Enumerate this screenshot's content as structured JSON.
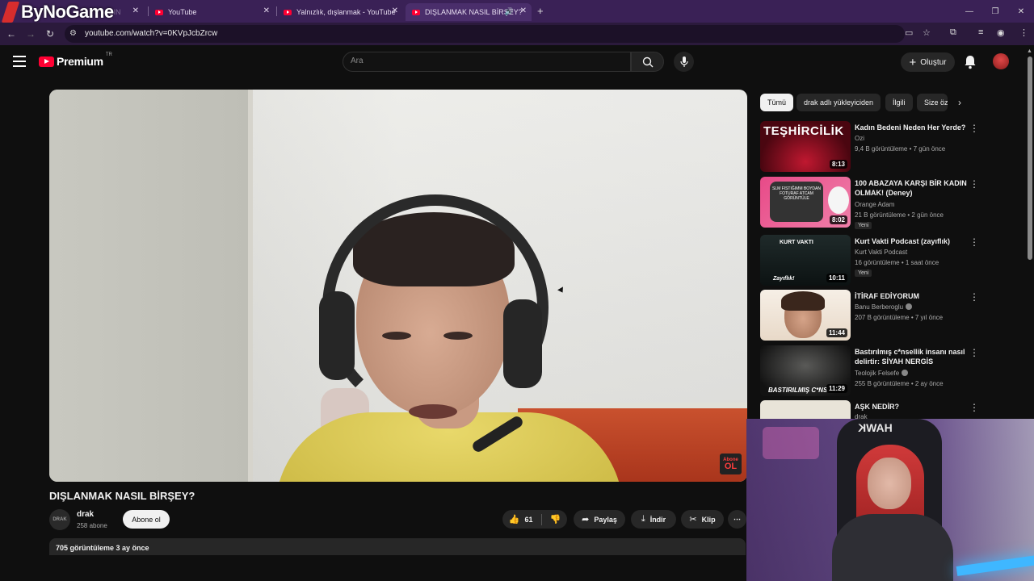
{
  "browser": {
    "watermark": "ByNoGame",
    "tabs": [
      {
        "title": "ÇIN"
      },
      {
        "title": "YouTube"
      },
      {
        "title": "Yalnızlık, dışlanmak - YouTube"
      },
      {
        "title": "DIŞLANMAK NASIL BİRŞEY?"
      }
    ],
    "url": "youtube.com/watch?v=0KVpJcbZrcw"
  },
  "header": {
    "logo_word": "Premium",
    "logo_region": "TR",
    "search_placeholder": "Ara",
    "create_label": "Oluştur"
  },
  "player": {
    "watermark_line1": "Abone",
    "watermark_line2": "OL"
  },
  "video": {
    "title": "DIŞLANMAK NASIL BİRŞEY?",
    "channel": "drak",
    "channel_avatar_text": "DRAK",
    "subscribers": "258 abone",
    "subscribe_label": "Abone ol",
    "likes": "61",
    "share_label": "Paylaş",
    "download_label": "İndir",
    "clip_label": "Klip",
    "views_date": "705 görüntüleme  3 ay önce"
  },
  "sidebar": {
    "chips": [
      {
        "label": "Tümü"
      },
      {
        "label": "drak adlı yükleyiciden"
      },
      {
        "label": "İlgili"
      },
      {
        "label": "Size öz"
      }
    ],
    "recommendations": [
      {
        "thumb_text": "TEŞHİRCİLİK",
        "duration": "8:13",
        "title": "Kadın Bedeni Neden Her Yerde?",
        "channel": "Ozi",
        "meta": "9,4 B görüntüleme • 7 gün önce"
      },
      {
        "thumb_text": "SLM FISTIĞIMM BOYDAN FOTURAF ATCAM GÖRÜNTÜLE",
        "duration": "8:02",
        "title": "100 ABAZAYA KARŞI BİR KADIN OLMAK! (Deney)",
        "channel": "Orange Adam",
        "meta": "21 B görüntüleme • 2 gün önce",
        "badge": "Yeni"
      },
      {
        "thumb_text": "KURT VAKTI",
        "thumb_text2": "Zayıflık!",
        "duration": "10:11",
        "title": "Kurt Vakti Podcast  (zayıflık)",
        "channel": "Kurt Vakti Podcast",
        "meta": "16 görüntüleme • 1 saat önce",
        "badge": "Yeni"
      },
      {
        "duration": "11:44",
        "title": "İTİRAF EDİYORUM",
        "channel": "Banu Berberoglu",
        "meta": "207 B görüntüleme • 7 yıl önce"
      },
      {
        "thumb_text": "BASTIRILMIŞ C*NS",
        "duration": "11:29",
        "title": "Bastırılmış c*nsellik insanı nasıl delirtir: SİYAH NERGİS",
        "channel": "Teolojik Felsefe",
        "meta": "255 B görüntüleme • 2 ay önce"
      },
      {
        "title": "AŞK NEDİR?",
        "channel": "drak"
      }
    ]
  },
  "overlay": {
    "chair_brand": "HAWK"
  },
  "colors": {
    "accent": "#ff0033",
    "browser_frame": "#3a2156",
    "page_bg": "#0f0f0f"
  }
}
